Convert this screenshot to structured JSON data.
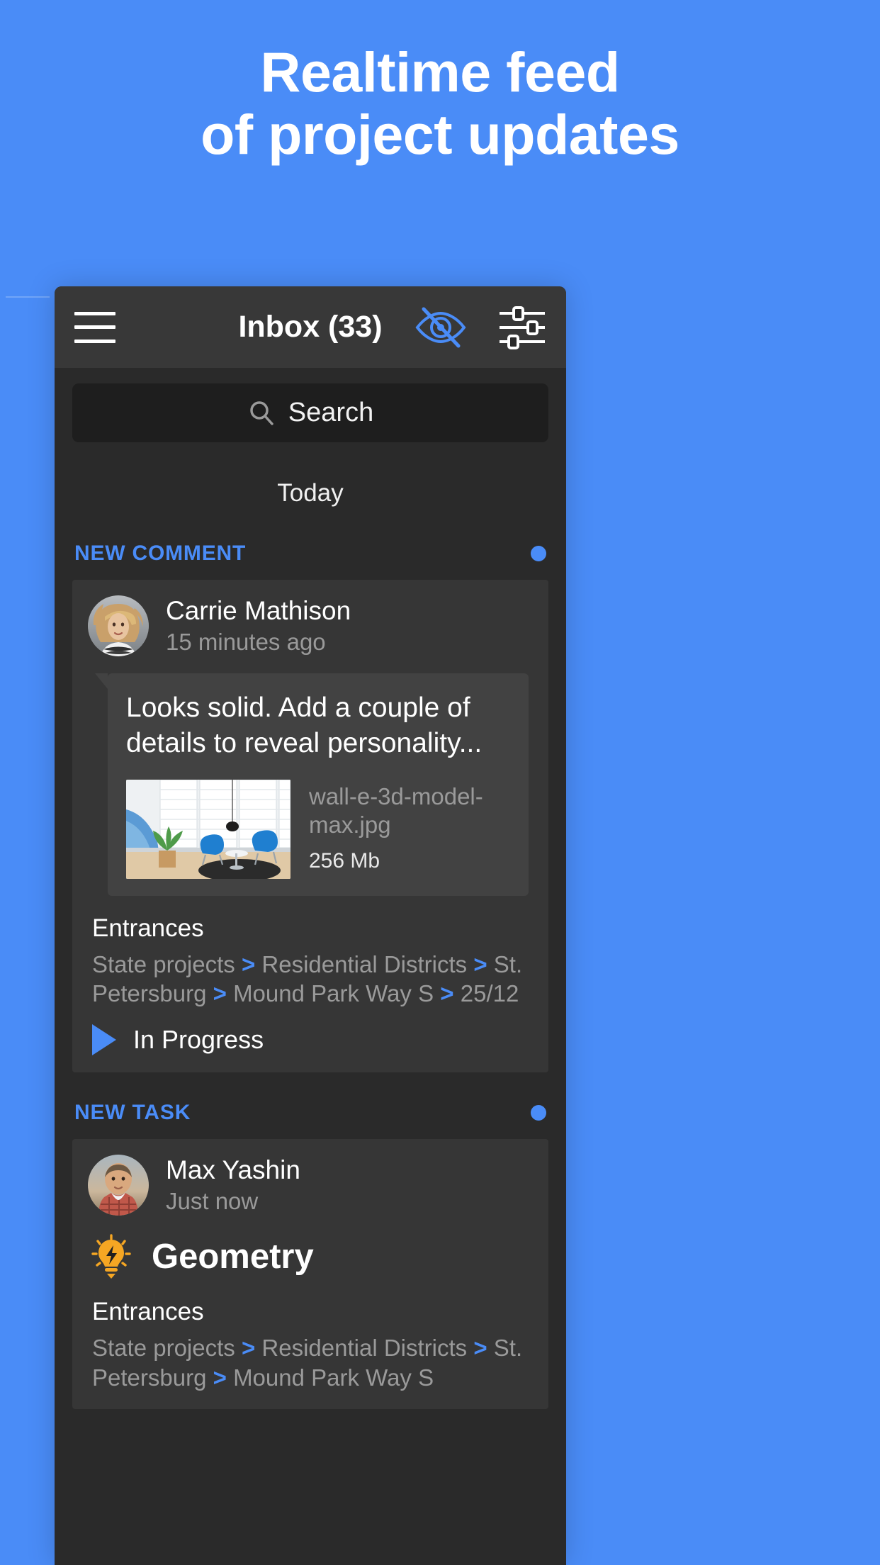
{
  "promo": {
    "line1": "Realtime feed",
    "line2": "of project updates"
  },
  "colors": {
    "background": "#4a8cf7",
    "accent": "#4a8cf7",
    "app_surface": "#2a2a2a",
    "toolbar": "#383838",
    "card": "#363636",
    "bubble": "#424242",
    "muted_text": "#9a9a9a",
    "bulb": "#F5A623"
  },
  "toolbar": {
    "title": "Inbox (33)",
    "menu_icon": "hamburger-menu-icon",
    "hide_icon": "eye-off-icon",
    "filter_icon": "sliders-filter-icon"
  },
  "search": {
    "placeholder": "Search",
    "icon": "search-icon"
  },
  "day_divider": "Today",
  "sections": [
    {
      "title": "NEW COMMENT",
      "unread": true,
      "item": {
        "author": "Carrie Mathison",
        "time": "15 minutes ago",
        "avatar": "avatar-carrie-mathison",
        "comment": "Looks solid. Add a couple of details to reveal personality...",
        "attachment": {
          "thumb": "interior-office-thumbnail",
          "filename": "wall-e-3d-model-max.jpg",
          "size": "256 Mb"
        },
        "task_name": "Entrances",
        "breadcrumb": [
          "State projects",
          "Residential Districts",
          "St. Petersburg",
          "Mound Park Way S",
          "25/12"
        ],
        "status": "In Progress",
        "status_icon": "play-triangle-icon"
      }
    },
    {
      "title": "NEW TASK",
      "unread": true,
      "item": {
        "author": "Max Yashin",
        "time": "Just now",
        "avatar": "avatar-max-yashin",
        "headline": "Geometry",
        "headline_icon": "lightbulb-idea-icon",
        "task_name": "Entrances",
        "breadcrumb": [
          "State projects",
          "Residential Districts",
          "St. Petersburg",
          "Mound Park Way S"
        ]
      }
    }
  ]
}
